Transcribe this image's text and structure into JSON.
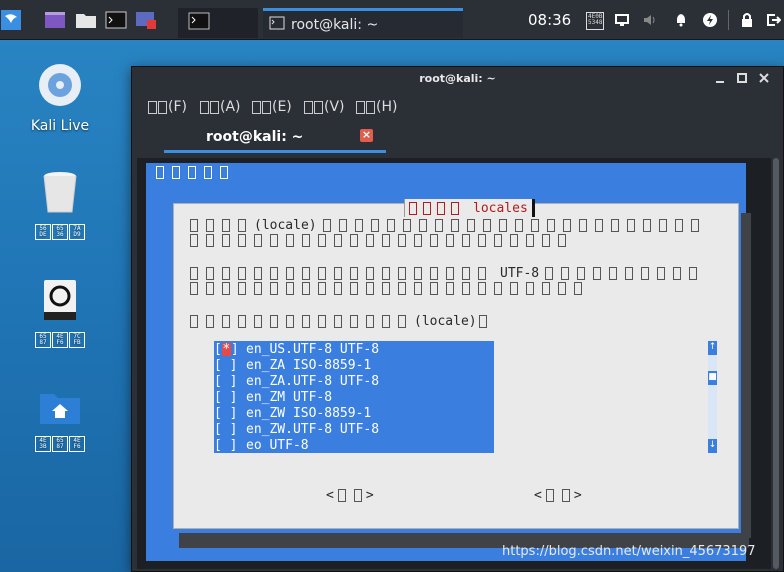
{
  "panel": {
    "taskbar": [
      {
        "name": "kali-menu",
        "icon": "kali-dragon-icon"
      },
      {
        "name": "app-launcher-1",
        "icon": "window-icon"
      },
      {
        "name": "app-launcher-2",
        "icon": "folder-icon"
      },
      {
        "name": "app-launcher-3",
        "icon": "terminal-icon"
      },
      {
        "name": "app-launcher-4",
        "icon": "screenshot-icon"
      }
    ],
    "workspace_icon": "terminal-icon",
    "task_title": "root@kali: ~",
    "clock": "08:36",
    "clock_box": [
      "4E",
      "0B",
      "53",
      "48"
    ],
    "tray": [
      "screen-icon",
      "volume-icon",
      "bell-icon",
      "power-icon",
      "lock-icon",
      "logout-icon"
    ]
  },
  "desktop": {
    "icons": [
      {
        "label": "Kali Live",
        "icon": "disc-icon"
      },
      {
        "label_boxes": [
          "56",
          "DE",
          "65",
          "36",
          "7A",
          "D9"
        ],
        "icon": "trash-icon"
      },
      {
        "label_boxes": [
          "65",
          "87",
          "4E",
          "F6",
          "7C",
          "FB"
        ],
        "icon": "drive-icon"
      },
      {
        "label_boxes": [
          "4E",
          "3B",
          "65",
          "87",
          "4E",
          "F6"
        ],
        "icon": "home-folder-icon"
      }
    ]
  },
  "window": {
    "title": "root@kali: ~",
    "menus": [
      {
        "boxes": 2,
        "label": "(F)"
      },
      {
        "boxes": 2,
        "label": "(A)"
      },
      {
        "boxes": 2,
        "label": "(E)"
      },
      {
        "boxes": 2,
        "label": "(V)"
      },
      {
        "boxes": 2,
        "label": "(H)"
      }
    ],
    "tab_title": "root@kali: ~",
    "tab_close": "×"
  },
  "dialog": {
    "backtitle_boxes": 5,
    "title_boxes": 4,
    "title_word": "locales",
    "para1": {
      "line1_pre_boxes": 4,
      "line1_word": "(locale)",
      "line1_post_boxes": 24,
      "line2_boxes": 24
    },
    "para2": {
      "line1_pre_boxes": 19,
      "line1_word": "UTF-8",
      "line1_post_boxes": 10,
      "line2_boxes": 25
    },
    "para3": {
      "pre_boxes": 14,
      "word": "(locale)"
    },
    "options": [
      {
        "checked": true,
        "text": "en_US.UTF-8 UTF-8"
      },
      {
        "checked": false,
        "text": "en_ZA ISO-8859-1"
      },
      {
        "checked": false,
        "text": "en_ZA.UTF-8 UTF-8"
      },
      {
        "checked": false,
        "text": "en_ZM UTF-8"
      },
      {
        "checked": false,
        "text": "en_ZW ISO-8859-1"
      },
      {
        "checked": false,
        "text": "en_ZW.UTF-8 UTF-8"
      },
      {
        "checked": false,
        "text": "eo UTF-8"
      }
    ],
    "buttons": [
      {
        "left": "<",
        "boxes": 2,
        "right": ">"
      },
      {
        "left": "<",
        "boxes": 2,
        "right": ">"
      }
    ]
  },
  "watermark": "https://blog.csdn.net/weixin_45673197"
}
